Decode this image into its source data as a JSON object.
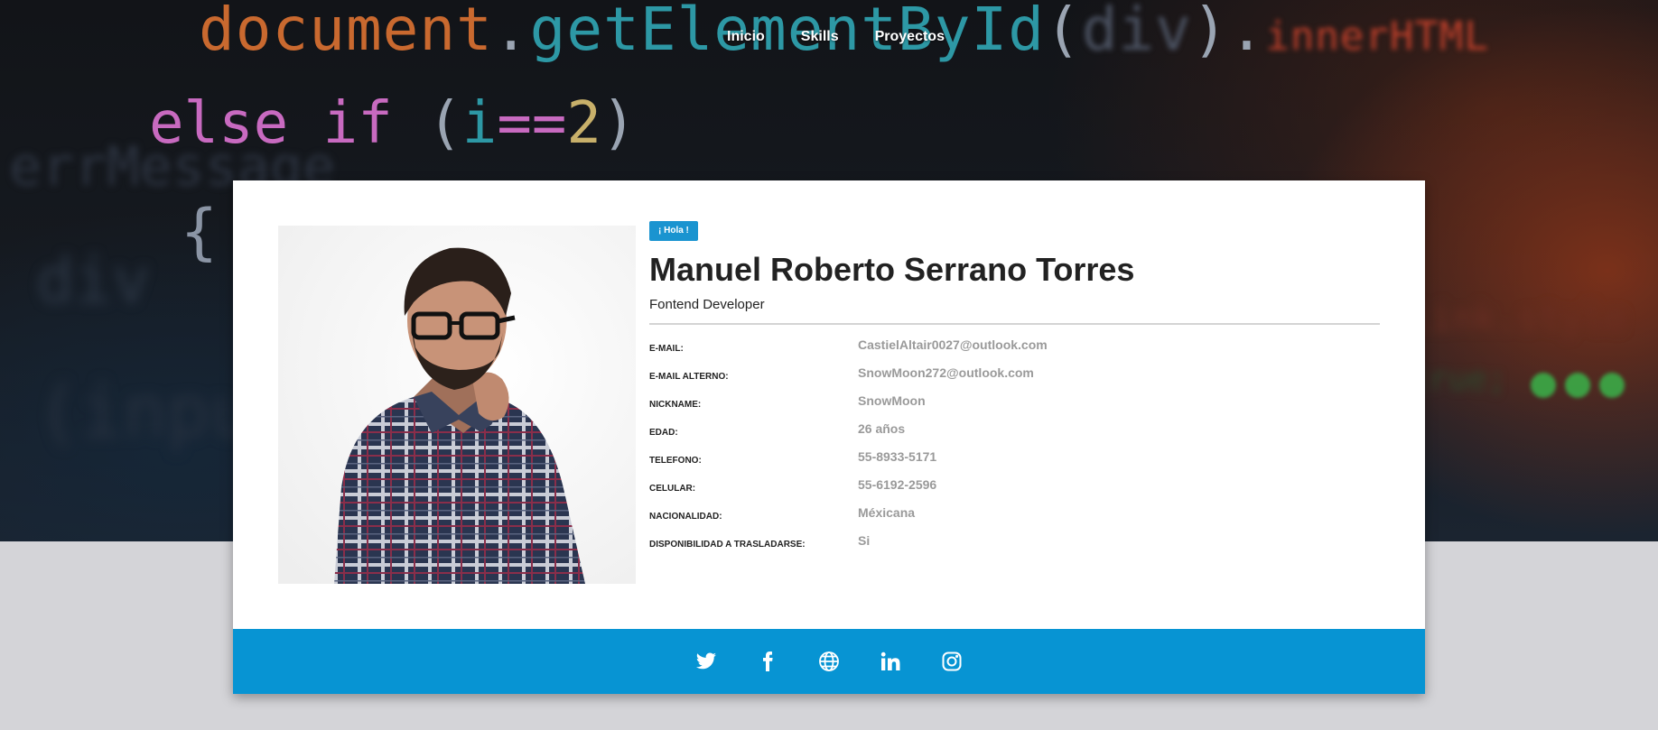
{
  "nav": {
    "items": [
      {
        "label": "Inicio"
      },
      {
        "label": "Skills"
      },
      {
        "label": "Proyectos"
      }
    ]
  },
  "profile": {
    "badge": "¡ Hola !",
    "name": "Manuel Roberto Serrano Torres",
    "role": "Fontend Developer",
    "fields": [
      {
        "key": "E-MAIL:",
        "value": "CastielAltair0027@outlook.com"
      },
      {
        "key": "E-MAIL ALTERNO:",
        "value": "SnowMoon272@outlook.com"
      },
      {
        "key": "NICKNAME:",
        "value": "SnowMoon"
      },
      {
        "key": "EDAD:",
        "value": "26 años"
      },
      {
        "key": "TELEFONO:",
        "value": "55-8933-5171"
      },
      {
        "key": "CELULAR:",
        "value": "55-6192-2596"
      },
      {
        "key": "NACIONALIDAD:",
        "value": "Méxicana"
      },
      {
        "key": "DISPONIBILIDAD A TRASLADARSE:",
        "value": "Si"
      }
    ]
  },
  "social": {
    "icons": [
      "twitter-icon",
      "facebook-icon",
      "globe-icon",
      "linkedin-icon",
      "instagram-icon"
    ]
  },
  "colors": {
    "accent": "#0794d3",
    "badge": "#1a94d0",
    "value_text": "#9a9a9a"
  }
}
